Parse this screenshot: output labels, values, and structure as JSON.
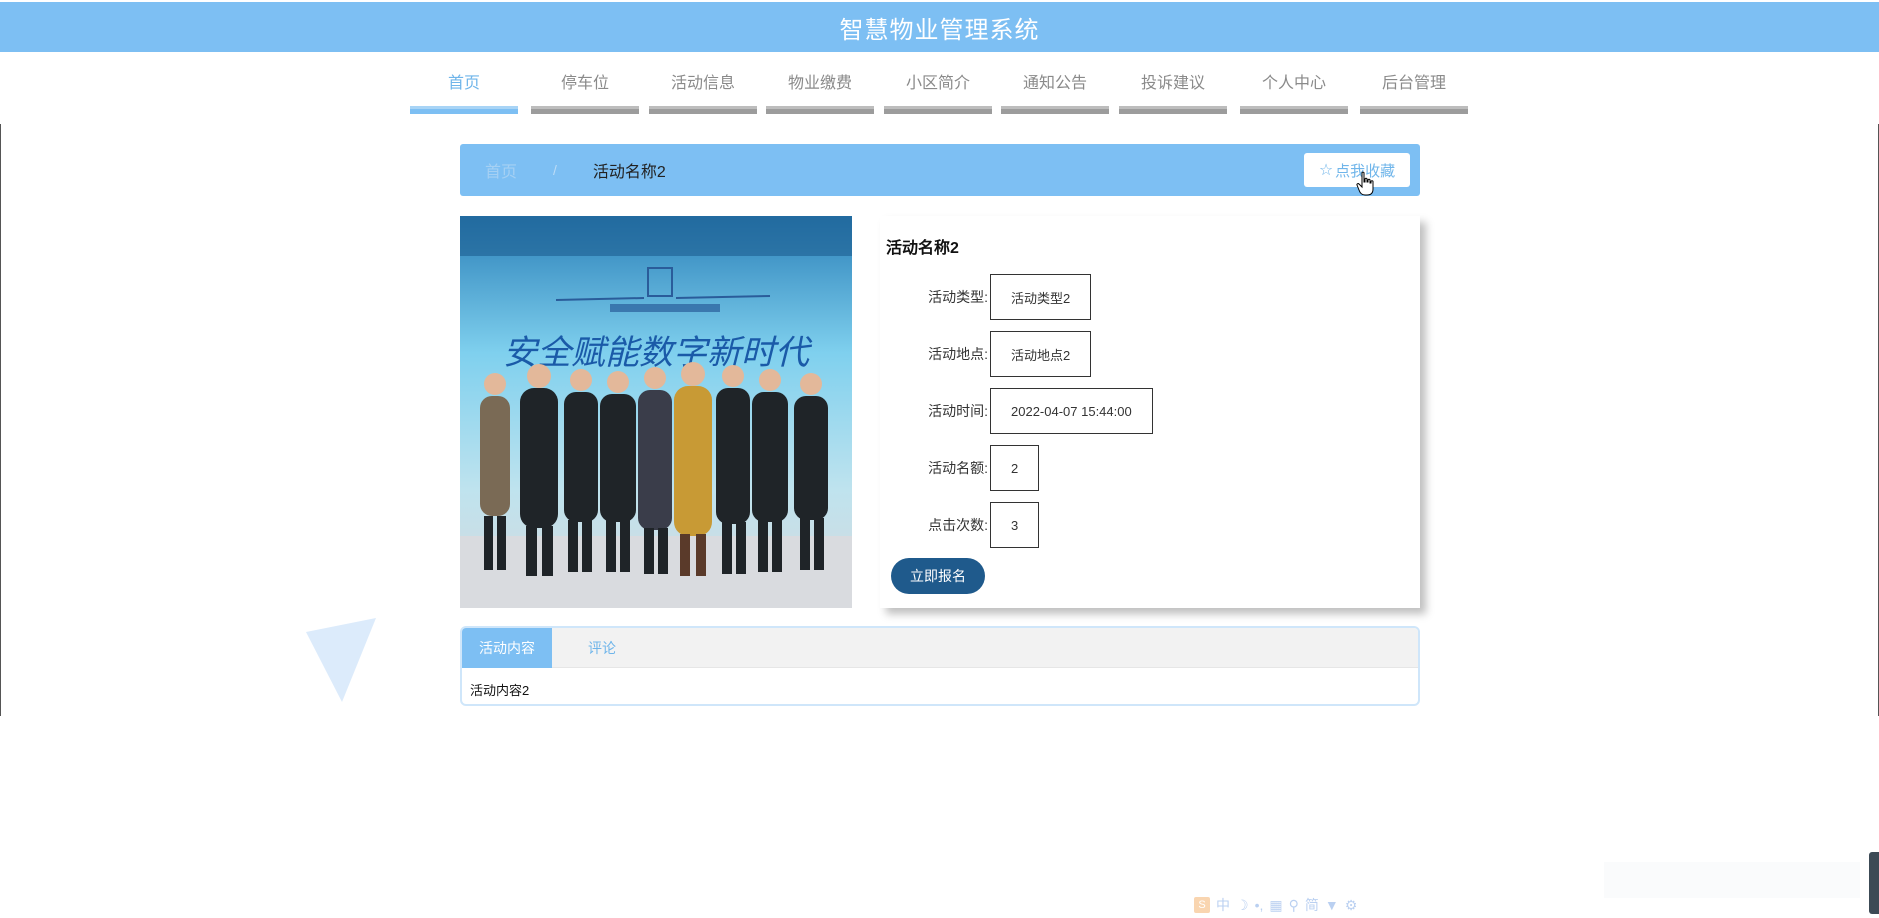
{
  "header": {
    "title": "智慧物业管理系统"
  },
  "nav": {
    "items": [
      {
        "label": "首页",
        "active": true
      },
      {
        "label": "停车位",
        "active": false
      },
      {
        "label": "活动信息",
        "active": false
      },
      {
        "label": "物业缴费",
        "active": false
      },
      {
        "label": "小区简介",
        "active": false
      },
      {
        "label": "通知公告",
        "active": false
      },
      {
        "label": "投诉建议",
        "active": false
      },
      {
        "label": "个人中心",
        "active": false
      },
      {
        "label": "后台管理",
        "active": false
      }
    ]
  },
  "breadcrumb": {
    "home": "首页",
    "separator": "/",
    "current": "活动名称2",
    "favorite_label": "点我收藏"
  },
  "detail": {
    "title": "活动名称2",
    "fields": [
      {
        "label": "活动类型:",
        "value": "活动类型2"
      },
      {
        "label": "活动地点:",
        "value": "活动地点2"
      },
      {
        "label": "活动时间:",
        "value": "2022-04-07 15:44:00"
      },
      {
        "label": "活动名额:",
        "value": "2"
      },
      {
        "label": "点击次数:",
        "value": "3"
      }
    ],
    "signup_label": "立即报名"
  },
  "image": {
    "banner_text": "安全赋能数字新时代"
  },
  "tabs": {
    "items": [
      {
        "label": "活动内容",
        "active": true
      },
      {
        "label": "评论",
        "active": false
      }
    ],
    "content": "活动内容2"
  },
  "ime_toolbar": {
    "glyphs": [
      "中",
      "简"
    ]
  },
  "colors": {
    "primary": "#7dbff3",
    "button_dark": "#1f5a8c",
    "nav_inactive_bar": "#9c9c9c"
  }
}
